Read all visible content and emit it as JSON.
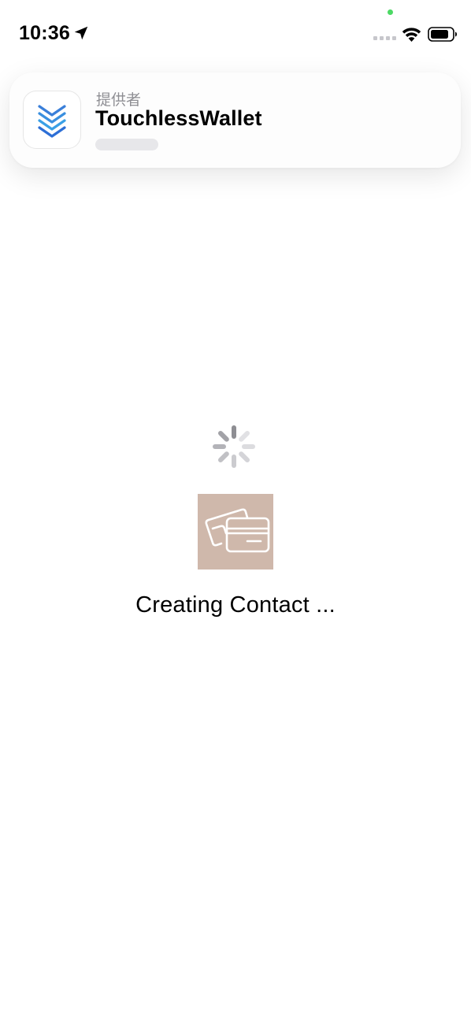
{
  "status_bar": {
    "time": "10:36",
    "icons": [
      "location-arrow-icon",
      "cellular-signal-icon",
      "wifi-icon",
      "battery-icon"
    ],
    "privacy_indicator_color": "#4cd964"
  },
  "banner": {
    "provider_label": "提供者",
    "app_name": "TouchlessWallet",
    "app_icon": "touchlesswallet-logo-icon",
    "accent_colors": [
      "#2d6fd6",
      "#3aa0e6"
    ]
  },
  "main": {
    "spinner_icon": "activity-spinner-icon",
    "thumbnail_icon": "cards-icon",
    "thumbnail_color": "#cfb8ab",
    "status_text": "Creating Contact ..."
  }
}
